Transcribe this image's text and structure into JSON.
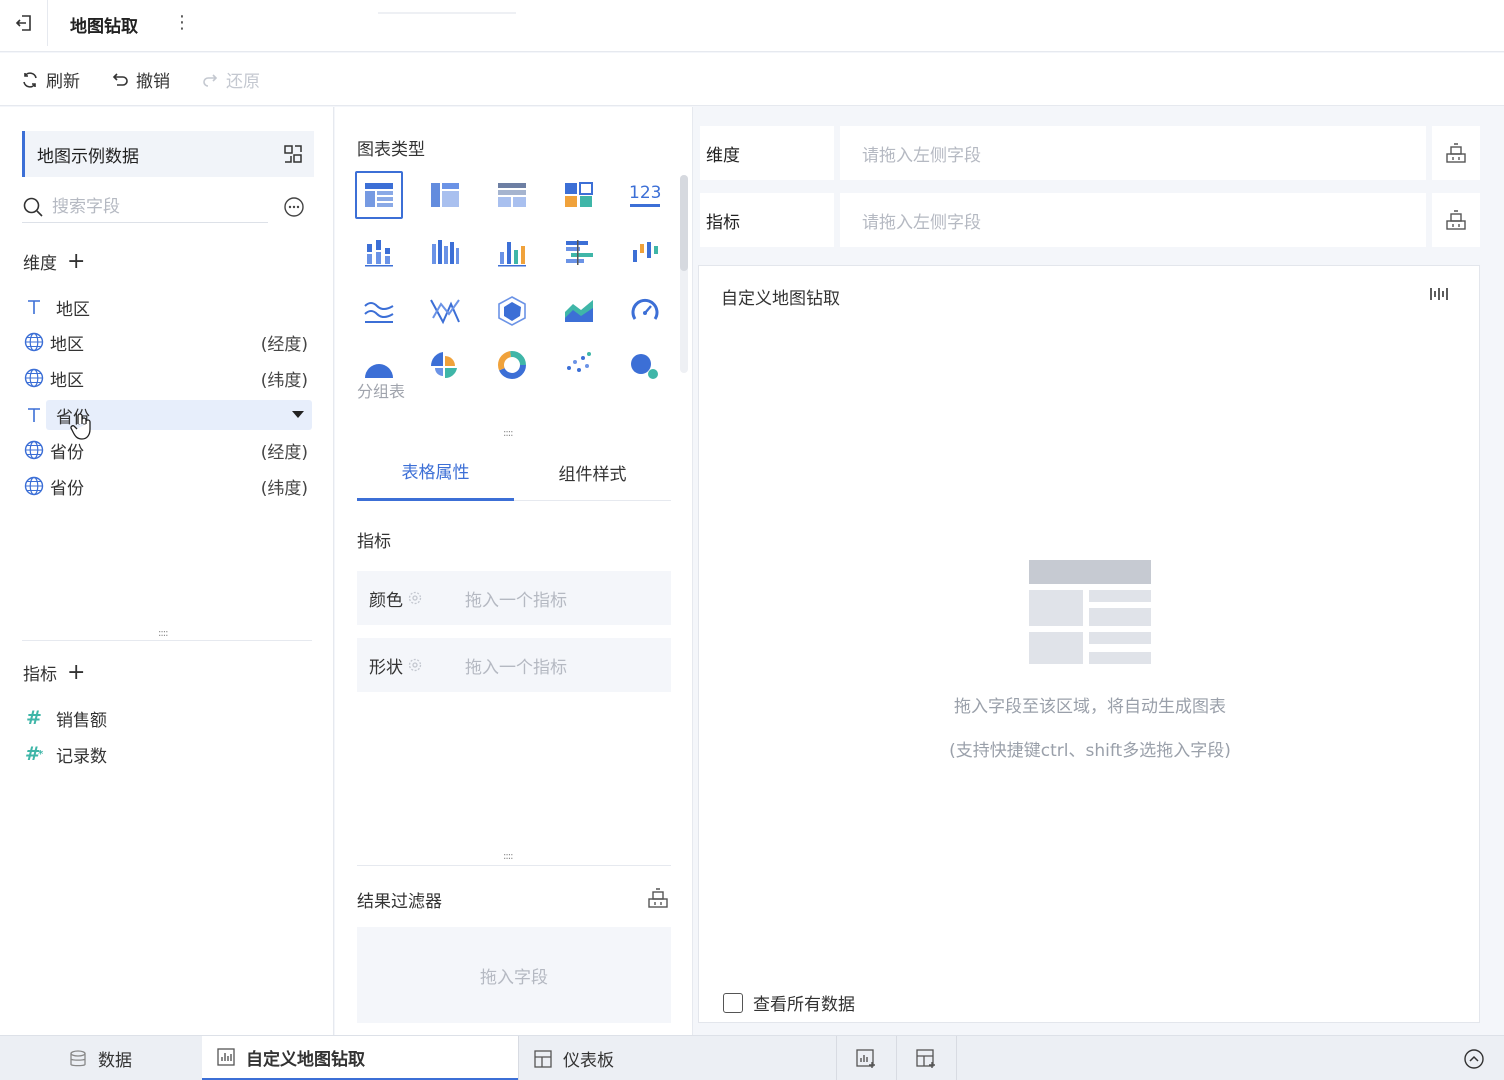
{
  "header": {
    "title": "地图钻取"
  },
  "toolbar": {
    "refresh": "刷新",
    "undo": "撤销",
    "redo": "还原"
  },
  "left": {
    "dataset": "地图示例数据",
    "search_placeholder": "搜索字段",
    "dimensions_label": "维度",
    "dimensions": [
      {
        "icon": "text-type-icon",
        "label": "地区",
        "suffix": ""
      },
      {
        "icon": "globe-icon",
        "label": "地区",
        "suffix": "(经度)"
      },
      {
        "icon": "globe-icon",
        "label": "地区",
        "suffix": "(纬度)"
      },
      {
        "icon": "text-type-icon",
        "label": "省份",
        "suffix": ""
      },
      {
        "icon": "globe-icon",
        "label": "省份",
        "suffix": "(经度)"
      },
      {
        "icon": "globe-icon",
        "label": "省份",
        "suffix": "(纬度)"
      }
    ],
    "measures_label": "指标",
    "measures": [
      {
        "icon": "number-icon",
        "label": "销售额"
      },
      {
        "icon": "calculated-number-icon",
        "label": "记录数"
      }
    ]
  },
  "middle": {
    "chart_type_label": "图表类型",
    "selected_chart_label": "分组表",
    "tabs": [
      "表格属性",
      "组件样式"
    ],
    "measure_label": "指标",
    "props": [
      {
        "key": "颜色",
        "placeholder": "拖入一个指标"
      },
      {
        "key": "形状",
        "placeholder": "拖入一个指标"
      }
    ],
    "filter_label": "结果过滤器",
    "filter_placeholder": "拖入字段"
  },
  "right": {
    "shelves": [
      {
        "key": "维度",
        "placeholder": "请拖入左侧字段"
      },
      {
        "key": "指标",
        "placeholder": "请拖入左侧字段"
      }
    ],
    "canvas_title": "自定义地图钻取",
    "hint1": "拖入字段至该区域，将自动生成图表",
    "hint2": "(支持快捷键ctrl、shift多选拖入字段)",
    "see_all": "查看所有数据"
  },
  "bottom": {
    "tabs": [
      "数据",
      "自定义地图钻取",
      "仪表板"
    ]
  },
  "colors": {
    "accent": "#3c6fd6",
    "teal": "#3fb6a8"
  }
}
